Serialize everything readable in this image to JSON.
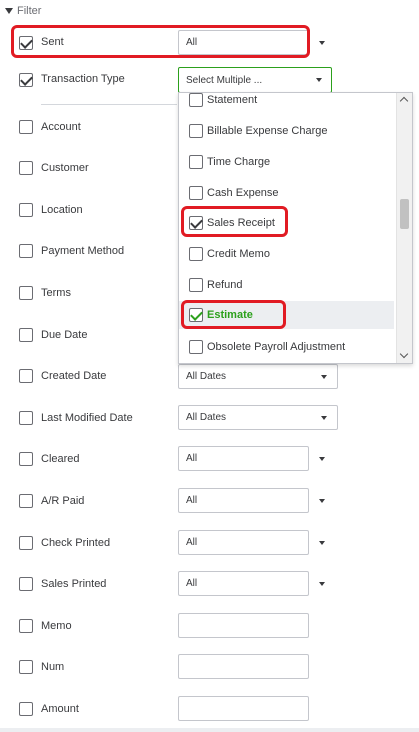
{
  "filter": {
    "header": "Filter"
  },
  "rows": [
    {
      "label": "Sent",
      "checked": true,
      "value": "All"
    },
    {
      "label": "Transaction Type",
      "checked": true,
      "value": "Select Multiple ..."
    },
    {
      "label": "Account",
      "checked": false
    },
    {
      "label": "Customer",
      "checked": false
    },
    {
      "label": "Location",
      "checked": false
    },
    {
      "label": "Payment Method",
      "checked": false
    },
    {
      "label": "Terms",
      "checked": false
    },
    {
      "label": "Due Date",
      "checked": false
    },
    {
      "label": "Created Date",
      "checked": false,
      "value": "All Dates"
    },
    {
      "label": "Last Modified Date",
      "checked": false,
      "value": "All Dates"
    },
    {
      "label": "Cleared",
      "checked": false,
      "value": "All"
    },
    {
      "label": "A/R Paid",
      "checked": false,
      "value": "All"
    },
    {
      "label": "Check Printed",
      "checked": false,
      "value": "All"
    },
    {
      "label": "Sales Printed",
      "checked": false,
      "value": "All"
    },
    {
      "label": "Memo",
      "checked": false,
      "value": ""
    },
    {
      "label": "Num",
      "checked": false,
      "value": ""
    },
    {
      "label": "Amount",
      "checked": false,
      "value": ""
    }
  ],
  "transaction_type_dropdown": {
    "items": [
      {
        "label": "Statement",
        "checked": false
      },
      {
        "label": "Billable Expense Charge",
        "checked": false
      },
      {
        "label": "Time Charge",
        "checked": false
      },
      {
        "label": "Cash Expense",
        "checked": false
      },
      {
        "label": "Sales Receipt",
        "checked": true
      },
      {
        "label": "Credit Memo",
        "checked": false
      },
      {
        "label": "Refund",
        "checked": false
      },
      {
        "label": "Estimate",
        "checked": true
      },
      {
        "label": "Obsolete Payroll Adjustment",
        "checked": false
      }
    ]
  },
  "colors": {
    "accent_green": "#2ca01c",
    "highlight_red": "#e11b23",
    "text": "#393a3d"
  }
}
